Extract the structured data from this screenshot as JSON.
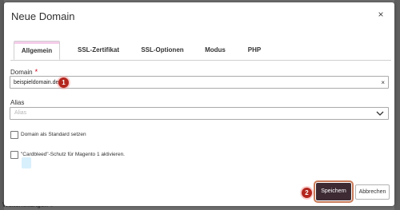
{
  "background": {
    "bottom_text": "Weiterleitungen ●"
  },
  "modal": {
    "title": "Neue Domain",
    "close_glyph": "×",
    "tabs": [
      {
        "label": "Allgemein",
        "active": true
      },
      {
        "label": "SSL-Zertifikat",
        "active": false
      },
      {
        "label": "SSL-Optionen",
        "active": false
      },
      {
        "label": "Modus",
        "active": false
      },
      {
        "label": "PHP",
        "active": false
      }
    ],
    "domain_field": {
      "label": "Domain",
      "required_mark": "*",
      "value": "beispieldomain.de",
      "clear_glyph": "×"
    },
    "alias_field": {
      "label": "Alias",
      "placeholder": "Alias"
    },
    "checkboxes": [
      {
        "label": "Domain als Standard setzen",
        "checked": false
      },
      {
        "label": "\"Cardbleed\"-Schutz für Magento 1 aktivieren.",
        "checked": false
      }
    ],
    "buttons": {
      "save": "Speichern",
      "cancel": "Abbrechen"
    },
    "step_badges": [
      "1",
      "2"
    ]
  },
  "colors": {
    "badge": "#b3261e",
    "save_button": "#3d2a33",
    "save_outline": "#c87a59",
    "required": "#d0021b"
  }
}
